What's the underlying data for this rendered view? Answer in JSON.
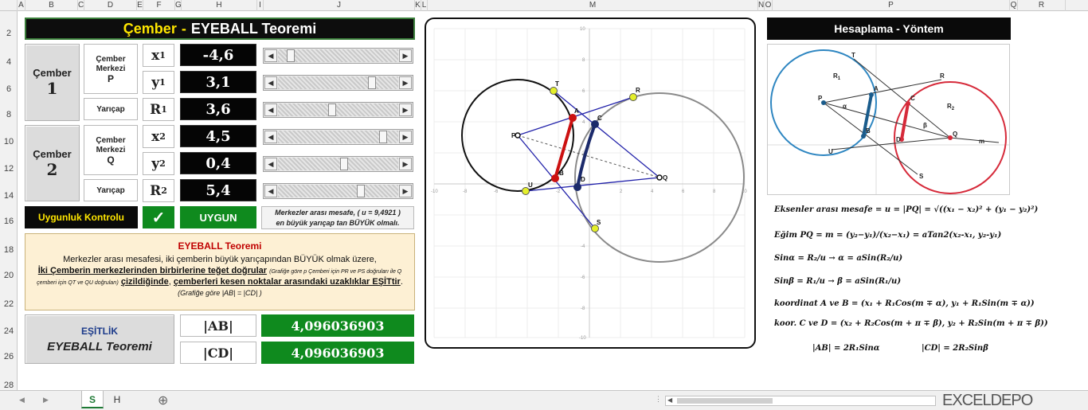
{
  "columns": [
    "A",
    "B",
    "C",
    "D",
    "E",
    "F",
    "G",
    "H",
    "I",
    "J",
    "K",
    "L",
    "M",
    "N",
    "O",
    "P",
    "Q",
    "R"
  ],
  "rows": [
    "2",
    "4",
    "6",
    "8",
    "10",
    "12",
    "14",
    "16",
    "18",
    "20",
    "22",
    "24",
    "26",
    "28"
  ],
  "title": {
    "part1": "Çember",
    "sep": "-",
    "part2": "EYEBALL  Teoremi"
  },
  "circle1": {
    "label_line1": "Çember",
    "label_line2": "1",
    "center_label_l1": "Çember",
    "center_label_l2": "Merkezi",
    "center_label_l3": "P",
    "radius_label": "Yarıçap",
    "x_var": "x",
    "x_sub": "1",
    "x_value": "-4,6",
    "x_slider": 0.08,
    "y_var": "y",
    "y_sub": "1",
    "y_value": "3,1",
    "y_slider": 0.8,
    "r_var": "R",
    "r_sub": "1",
    "r_value": "3,6",
    "r_slider": 0.45
  },
  "circle2": {
    "label_line1": "Çember",
    "label_line2": "2",
    "center_label_l1": "Çember",
    "center_label_l2": "Merkezi",
    "center_label_l3": "Q",
    "radius_label": "Yarıçap",
    "x_var": "x",
    "x_sub": "2",
    "x_value": "4,5",
    "x_slider": 0.9,
    "y_var": "y",
    "y_sub": "2",
    "y_value": "0,4",
    "y_slider": 0.55,
    "r_var": "R",
    "r_sub": "2",
    "r_value": "5,4",
    "r_slider": 0.7
  },
  "check": {
    "label": "Uygunluk Kontrolu",
    "mark": "✓",
    "status": "UYGUN",
    "note_line1": "Merkezler arası mesafe,  ( u = 9,4921 )",
    "note_line2": "en büyük yarıçap tan BÜYÜK olmalı."
  },
  "theorem": {
    "heading": "EYEBALL Teoremi",
    "line1": "Merkezler arası mesafesi, iki çemberin  büyük yarıçapından  BÜYÜK olmak üzere,",
    "line2_a": "İki Çemberin merkezlerinden birbirlerine teğet doğrular",
    "line2_b": "(Grafiğe göre p Çemberi için PR ve PS doğruları ile Q",
    "line3_a": "çemberi için QT ve QU doğruları)",
    "line3_b": "çizildiğinde",
    "line3_c": ",",
    "line3_d": "çemberleri  kesen noktalar arasındaki uzaklıklar EŞİTtir",
    "line3_e": ".",
    "line4": "(Grafiğe göre  |AB| = |CD| )"
  },
  "equality": {
    "label1": "EŞİTLİK",
    "label2": "EYEBALL Teoremi",
    "ab_label": "|AB|",
    "cd_label": "|CD|",
    "ab_value": "4,096036903",
    "cd_value": "4,096036903"
  },
  "plot": {
    "axis_min": -10,
    "axis_max": 10,
    "tick_labels": [
      "-10",
      "-8",
      "-6",
      "-4",
      "-2",
      "2",
      "4",
      "6",
      "8",
      "10"
    ],
    "y_tick_labels": [
      "10",
      "8",
      "6",
      "4",
      "2",
      "-2",
      "-4",
      "-6",
      "-8",
      "-10"
    ],
    "points": {
      "P": {
        "label": "P"
      },
      "Q": {
        "label": "Q"
      },
      "A": {
        "label": "A"
      },
      "B": {
        "label": "B"
      },
      "C": {
        "label": "C"
      },
      "D": {
        "label": "D"
      },
      "R": {
        "label": "R"
      },
      "S": {
        "label": "S"
      },
      "T": {
        "label": "T"
      },
      "U": {
        "label": "U"
      }
    }
  },
  "method": {
    "heading": "Hesaplama - Yöntem",
    "diagram_labels": {
      "P": "P",
      "Q": "Q",
      "A": "A",
      "B": "B",
      "C": "C",
      "D": "D",
      "R": "R",
      "S": "S",
      "T": "T",
      "U": "U",
      "R1": "R",
      "R1sub": "1",
      "R2": "R",
      "R2sub": "2",
      "alpha": "α",
      "beta": "β",
      "m": "m"
    },
    "f1_label": "Eksenler arası mesafe = u = |PQ| = ",
    "f1_expr": "√((x₁ − x₂)² + (y₁ − y₂)²)",
    "f2_label": "Eğim PQ = m = ",
    "f2_expr": "(y₂−y₁)/(x₂−x₁) = aTan2(x₂-x₁, y₂-y₁)",
    "f3": "Sinα = R₂/u   →    α = aSin(R₂/u)",
    "f4": "Sinβ = R₁/u   →    β = aSin(R₁/u)",
    "f5": "koordinat  A ve B = (x₁ + R₁Cos(m ∓ α), y₁ + R₁Sin(m ∓ α))",
    "f6": "koor.  C ve D = (x₂ + R₂Cos(m + π ∓ β), y₂ + R₂Sin(m + π ∓ β))",
    "f7a": "|AB| = 2R₁Sinα",
    "f7b": "|CD| = 2R₂Sinβ"
  },
  "sheet_tabs": [
    "S",
    "H"
  ],
  "add_sheet": "⊕",
  "watermark": "EXCELDEPO"
}
